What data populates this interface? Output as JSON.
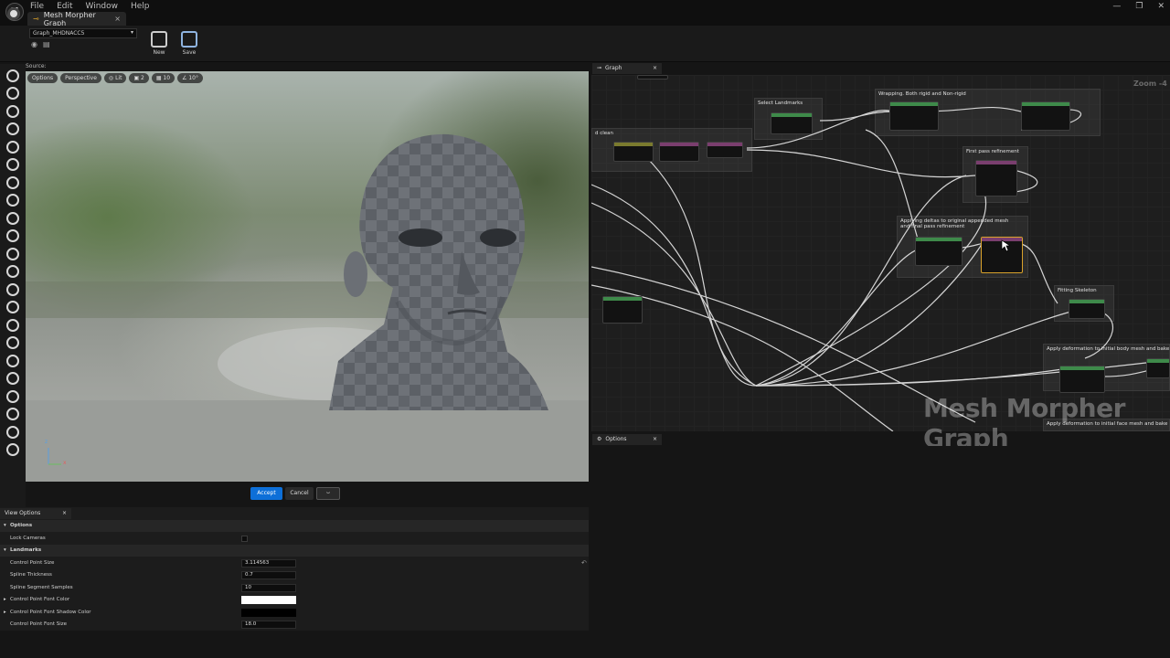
{
  "menu": [
    "File",
    "Edit",
    "Window",
    "Help"
  ],
  "doc_tab": {
    "label": "Mesh Morpher Graph",
    "close": "×"
  },
  "window_controls": [
    "—",
    "❐",
    "✕"
  ],
  "toolbar": {
    "graph_select": "Graph_MHDNACC5",
    "new_label": "New",
    "save_label": "Save"
  },
  "viewport": {
    "source_label": "Source:",
    "chips": [
      "Options",
      "Perspective",
      "Lit",
      "2",
      "10",
      "10°"
    ],
    "axis_x": "x",
    "axis_z": "z"
  },
  "dialog": {
    "accept": "Accept",
    "cancel": "Cancel",
    "extra": "⌣"
  },
  "view_options": {
    "tab": "View Options",
    "close": "×",
    "rows": [
      {
        "type": "cat",
        "label": "Options"
      },
      {
        "type": "check",
        "label": "Lock Cameras"
      },
      {
        "type": "cat",
        "label": "Landmarks"
      },
      {
        "type": "value",
        "label": "Control Point Size",
        "value": "3.114563",
        "reset": true
      },
      {
        "type": "value",
        "label": "Spline Thickness",
        "value": "0.7"
      },
      {
        "type": "value",
        "label": "Spline Segment Samples",
        "value": "10"
      },
      {
        "type": "color",
        "label": "Control Point Font Color",
        "color": "#ffffff",
        "expand": true
      },
      {
        "type": "color",
        "label": "Control Point Font Shadow Color",
        "color": "#000000",
        "expand": true
      },
      {
        "type": "value",
        "label": "Control Point Font Size",
        "value": "18.0"
      }
    ]
  },
  "graph": {
    "tab": "Graph",
    "close": "×",
    "zoom": "Zoom -4",
    "watermark": "Mesh Morpher Graph",
    "comments": [
      "Wrapping. Both rigid and Non-rigid",
      "Select Landmarks",
      "d clean",
      "First pass refinement",
      "Applying deltas to original appended mesh and final pass refinement",
      "Fitting Skeleton",
      "Apply deformation to initial body mesh and bake",
      "Apply deformation to initial face mesh and bake"
    ]
  },
  "options": {
    "tab": "Options",
    "close": "×"
  },
  "colors": {
    "accent": "#0d6fd8",
    "selection": "#d9a22b"
  }
}
